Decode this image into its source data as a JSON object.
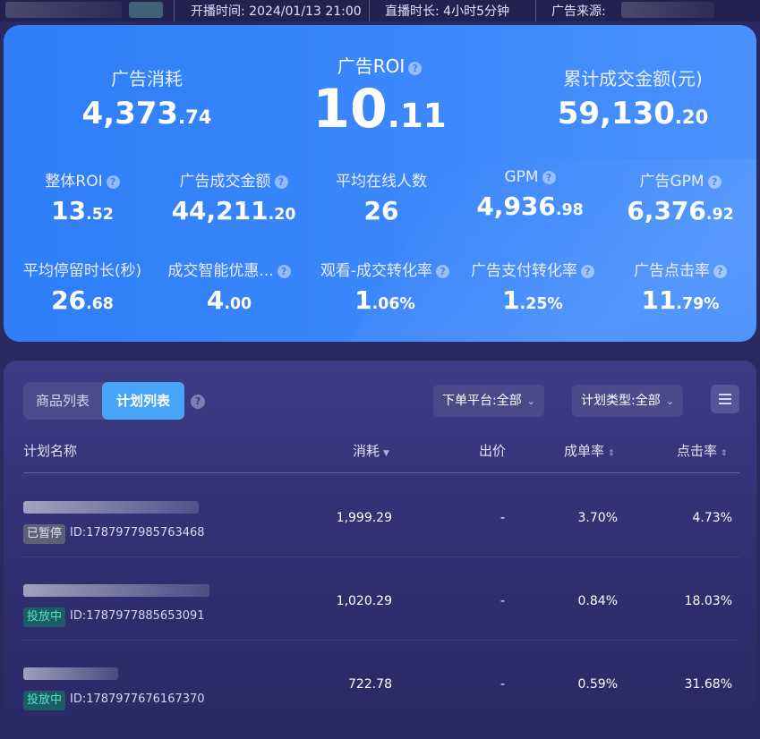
{
  "topbar": {
    "start_time_label": "开播时间:",
    "start_time": "2024/01/13 21:00",
    "duration_label": "直播时长:",
    "duration": "4小时5分钟",
    "source_label": "广告来源:"
  },
  "summary": {
    "ad_spend": {
      "label": "广告消耗",
      "int": "4,373",
      "dec": ".74"
    },
    "ad_roi": {
      "label": "广告ROI",
      "int": "10",
      "dec": ".11"
    },
    "total_gmv": {
      "label": "累计成交金额(元)",
      "int": "59,130",
      "dec": ".20"
    }
  },
  "metrics_row1": [
    {
      "label": "整体ROI",
      "int": "13",
      "dec": ".52",
      "help": true
    },
    {
      "label": "广告成交金额",
      "int": "44,211",
      "dec": ".20",
      "help": true
    },
    {
      "label": "平均在线人数",
      "int": "26",
      "dec": "",
      "help": false
    },
    {
      "label": "GPM",
      "int": "4,936",
      "dec": ".98",
      "help": true
    },
    {
      "label": "广告GPM",
      "int": "6,376",
      "dec": ".92",
      "help": true
    }
  ],
  "metrics_row2": [
    {
      "label": "平均停留时长(秒)",
      "int": "26",
      "dec": ".68",
      "help": false
    },
    {
      "label": "成交智能优惠...",
      "int": "4",
      "dec": ".00",
      "help": true
    },
    {
      "label": "观看-成交转化率",
      "int": "1",
      "dec": ".06%",
      "help": true
    },
    {
      "label": "广告支付转化率",
      "int": "1",
      "dec": ".25%",
      "help": true
    },
    {
      "label": "广告点击率",
      "int": "11",
      "dec": ".79%",
      "help": true
    }
  ],
  "panel": {
    "tab_products": "商品列表",
    "tab_plans": "计划列表",
    "platform_filter": "下单平台:全部",
    "plan_type_filter": "计划类型:全部"
  },
  "table": {
    "headers": {
      "name": "计划名称",
      "spend": "消耗",
      "bid": "出价",
      "conv_rate": "成单率",
      "ctr": "点击率"
    },
    "rows": [
      {
        "status": "已暂停",
        "status_type": "paused",
        "id": "ID:1787977985763468",
        "spend": "1,999.29",
        "bid": "-",
        "conv_rate": "3.70%",
        "ctr": "4.73%"
      },
      {
        "status": "投放中",
        "status_type": "live",
        "id": "ID:1787977885653091",
        "spend": "1,020.29",
        "bid": "-",
        "conv_rate": "0.84%",
        "ctr": "18.03%"
      },
      {
        "status": "投放中",
        "status_type": "live",
        "id": "ID:1787977676167370",
        "spend": "722.78",
        "bid": "-",
        "conv_rate": "0.59%",
        "ctr": "31.68%"
      }
    ]
  },
  "colors": {
    "card_blue": "#3b86fb",
    "panel_bg": "#302e70",
    "tab_active": "#47a4f8",
    "live_text": "#55e3c2"
  },
  "icons": [
    "help-icon",
    "chevron-down-icon",
    "sort-icon",
    "filter-settings-icon"
  ]
}
